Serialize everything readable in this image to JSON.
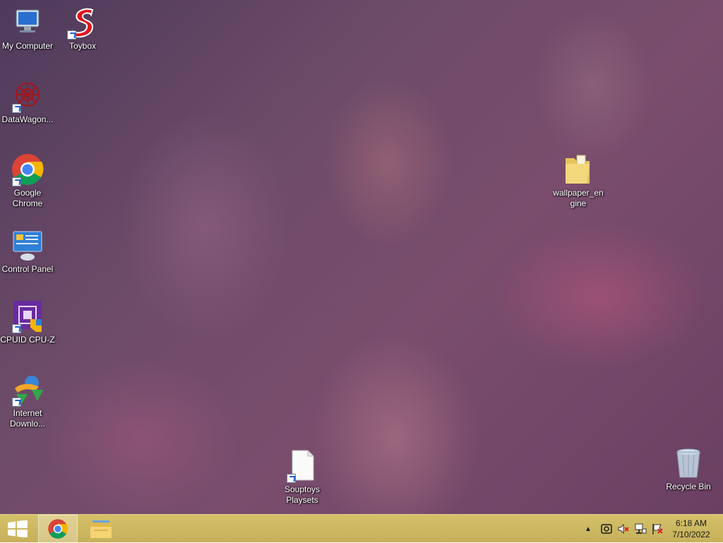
{
  "desktop": {
    "icons": [
      {
        "label": "My Computer"
      },
      {
        "label": "Toybox"
      },
      {
        "label": "DataWagon..."
      },
      {
        "label": "Google Chrome"
      },
      {
        "label": "Control Panel"
      },
      {
        "label": "CPUID CPU-Z"
      },
      {
        "label": "Internet Downlo..."
      },
      {
        "label": "wallpaper_engine"
      },
      {
        "label": "Souptoys Playsets"
      },
      {
        "label": "Recycle Bin"
      }
    ]
  },
  "taskbar": {
    "pinned": [
      "windows-logo-icon",
      "chrome-icon",
      "file-explorer-icon"
    ],
    "tray": {
      "icons": [
        "show-hidden-icons-chevron",
        "network-sharing-icon",
        "volume-muted-icon",
        "network-icon",
        "action-center-flag-icon"
      ]
    },
    "clock": {
      "time": "6:18 AM",
      "date": "7/10/2022"
    }
  },
  "colors": {
    "taskbar": "#c9b560",
    "accent_chrome_red": "#db4437",
    "chrome_green": "#0f9d58",
    "chrome_yellow": "#f4b400",
    "chrome_blue": "#4285f4"
  }
}
